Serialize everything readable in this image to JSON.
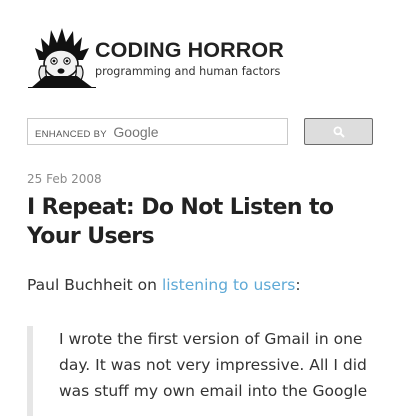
{
  "site": {
    "title": "CODING HORROR",
    "tagline": "programming and human factors"
  },
  "search": {
    "brand_prefix": "ENHANCED BY",
    "brand_name": "Google",
    "button_icon": "search-icon"
  },
  "post": {
    "date": "25 Feb 2008",
    "title": "I Repeat: Do Not Listen to Your Users",
    "intro_prefix": "Paul Buchheit on",
    "intro_link": "listening to users",
    "intro_suffix": ":",
    "quote": "I wrote the first version of Gmail in one day. It was not very impressive. All I did was stuff my own email into the Google"
  },
  "colors": {
    "link": "#5ea9d6",
    "date": "#8a8a8a",
    "quote_bar": "#e6e6e6"
  }
}
